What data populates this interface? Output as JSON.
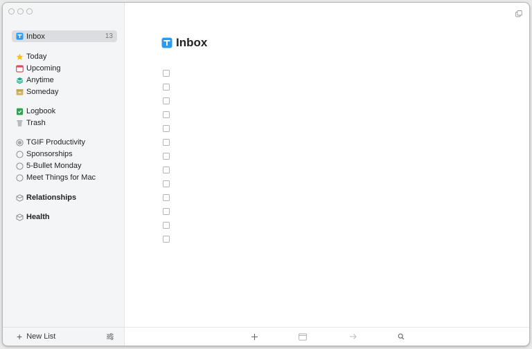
{
  "sidebar": {
    "inbox": {
      "label": "Inbox",
      "count": "13"
    },
    "today": {
      "label": "Today"
    },
    "upcoming": {
      "label": "Upcoming"
    },
    "anytime": {
      "label": "Anytime"
    },
    "someday": {
      "label": "Someday"
    },
    "logbook": {
      "label": "Logbook"
    },
    "trash": {
      "label": "Trash"
    },
    "projects": [
      {
        "label": "TGIF Productivity"
      },
      {
        "label": "Sponsorships"
      },
      {
        "label": "5-Bullet Monday"
      },
      {
        "label": "Meet Things for Mac"
      }
    ],
    "areas": [
      {
        "label": "Relationships"
      },
      {
        "label": "Health"
      }
    ],
    "footer": {
      "new_list_label": "New List"
    }
  },
  "main": {
    "title": "Inbox",
    "todo_count": 13
  },
  "colors": {
    "inbox_blue": "#2b9af3",
    "today_yellow": "#f5c31a",
    "upcoming_red": "#e8495f",
    "anytime_teal": "#1ca88d",
    "someday_tan": "#d1b56a",
    "logbook_green": "#2fa14f"
  }
}
